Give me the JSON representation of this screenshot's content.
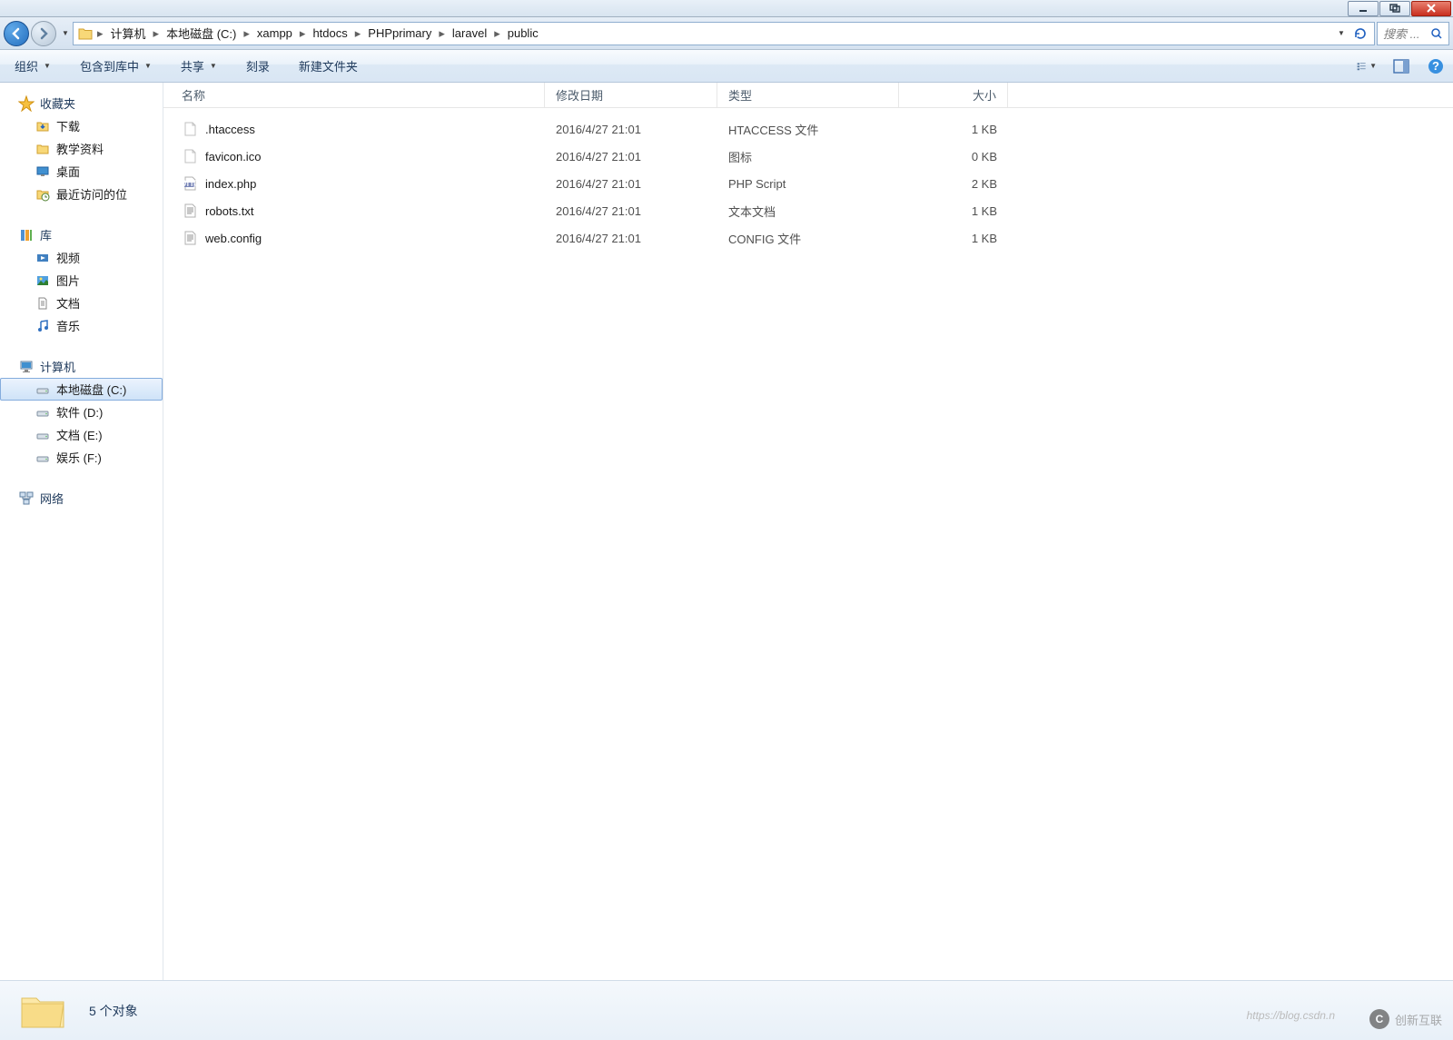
{
  "window": {
    "titlebar": {}
  },
  "breadcrumb": {
    "items": [
      "计算机",
      "本地磁盘 (C:)",
      "xampp",
      "htdocs",
      "PHPprimary",
      "laravel",
      "public"
    ]
  },
  "search": {
    "placeholder": "搜索 ..."
  },
  "toolbar": {
    "organize": "组织",
    "include": "包含到库中",
    "share": "共享",
    "burn": "刻录",
    "newfolder": "新建文件夹"
  },
  "sidebar": {
    "favorites": {
      "label": "收藏夹",
      "items": [
        {
          "label": "下载",
          "icon": "download"
        },
        {
          "label": "教学资料",
          "icon": "folder"
        },
        {
          "label": "桌面",
          "icon": "desktop"
        },
        {
          "label": "最近访问的位",
          "icon": "recent"
        }
      ]
    },
    "libraries": {
      "label": "库",
      "items": [
        {
          "label": "视频",
          "icon": "video"
        },
        {
          "label": "图片",
          "icon": "picture"
        },
        {
          "label": "文档",
          "icon": "document"
        },
        {
          "label": "音乐",
          "icon": "music"
        }
      ]
    },
    "computer": {
      "label": "计算机",
      "items": [
        {
          "label": "本地磁盘 (C:)",
          "icon": "drive",
          "selected": true
        },
        {
          "label": "软件 (D:)",
          "icon": "drive"
        },
        {
          "label": "文档 (E:)",
          "icon": "drive"
        },
        {
          "label": "娱乐 (F:)",
          "icon": "drive"
        }
      ]
    },
    "network": {
      "label": "网络"
    }
  },
  "columns": {
    "name": "名称",
    "date": "修改日期",
    "type": "类型",
    "size": "大小"
  },
  "files": [
    {
      "name": ".htaccess",
      "date": "2016/4/27 21:01",
      "type": "HTACCESS 文件",
      "size": "1 KB",
      "icon": "blank"
    },
    {
      "name": "favicon.ico",
      "date": "2016/4/27 21:01",
      "type": "图标",
      "size": "0 KB",
      "icon": "blank"
    },
    {
      "name": "index.php",
      "date": "2016/4/27 21:01",
      "type": "PHP Script",
      "size": "2 KB",
      "icon": "php"
    },
    {
      "name": "robots.txt",
      "date": "2016/4/27 21:01",
      "type": "文本文档",
      "size": "1 KB",
      "icon": "text"
    },
    {
      "name": "web.config",
      "date": "2016/4/27 21:01",
      "type": "CONFIG 文件",
      "size": "1 KB",
      "icon": "text"
    }
  ],
  "status": {
    "text": "5 个对象"
  },
  "watermark": {
    "brand": "创新互联",
    "url": "https://blog.csdn.n"
  }
}
